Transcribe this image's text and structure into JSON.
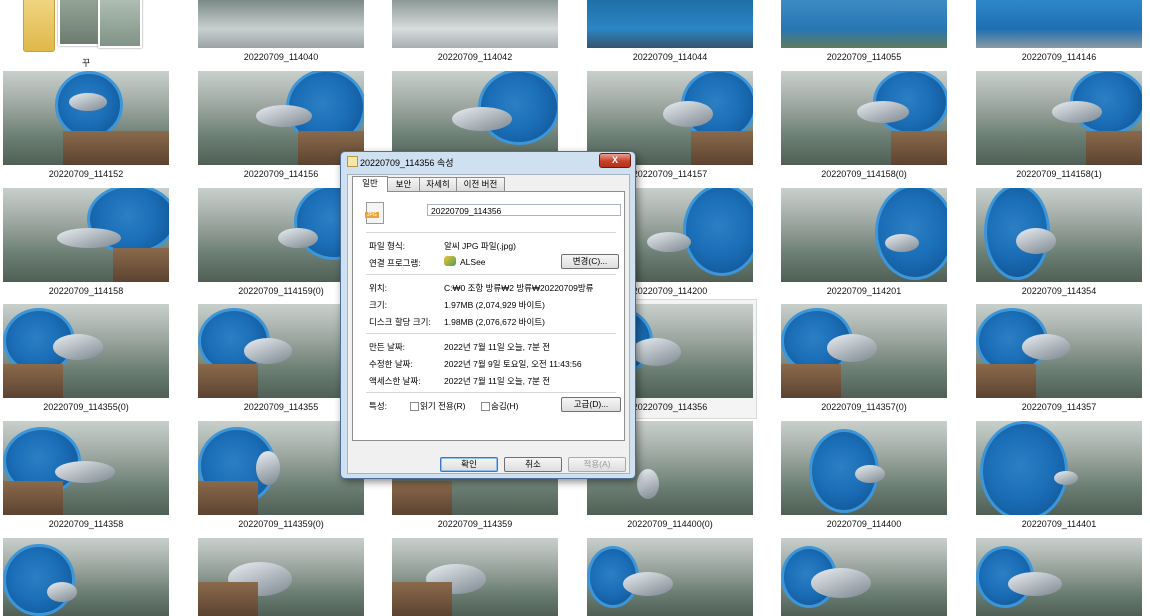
{
  "folder_caption": "꾸",
  "row0": [
    "20220709_114040",
    "20220709_114042",
    "20220709_114044",
    "20220709_114055",
    "20220709_114146"
  ],
  "row1": [
    "20220709_114152",
    "20220709_114156",
    "",
    "20220709_114157",
    "20220709_114158(0)",
    "20220709_114158(1)"
  ],
  "row2": [
    "20220709_114158",
    "20220709_114159(0)",
    "",
    "20220709_114200",
    "20220709_114201",
    "20220709_114354"
  ],
  "row3": [
    "20220709_114355(0)",
    "20220709_114355",
    "",
    "20220709_114356",
    "20220709_114357(0)",
    "20220709_114357"
  ],
  "row4": [
    "20220709_114358",
    "20220709_114359(0)",
    "20220709_114359",
    "20220709_114400(0)",
    "20220709_114400",
    "20220709_114401"
  ],
  "dialog": {
    "title": "20220709_114356 속성",
    "close_label": "X",
    "tabs": [
      "일반",
      "보안",
      "자세히",
      "이전 버전"
    ],
    "file_icon_text": "JPG",
    "filename": "20220709_114356",
    "type_label": "파일 형식:",
    "type_value": "알씨 JPG 파일(.jpg)",
    "opens_label": "연결 프로그램:",
    "opens_value": "ALSee",
    "change_button": "변경(C)...",
    "location_label": "위치:",
    "location_value": "C:₩0 조항 방류₩2 방류₩20220709방류",
    "size_label": "크기:",
    "size_value": "1.97MB (2,074,929 바이트)",
    "disk_label": "디스크 할당 크기:",
    "disk_value": "1.98MB (2,076,672 바이트)",
    "created_label": "만든 날짜:",
    "created_value": "2022년 7월 11일 오늘, 7분 전",
    "modified_label": "수정한 날짜:",
    "modified_value": "2022년 7월 9일 토요일, 오전 11:43:56",
    "accessed_label": "액세스한 날짜:",
    "accessed_value": "2022년 7월 11일 오늘, 7분 전",
    "attributes_label": "특성:",
    "readonly_label": "읽기 전용(R)",
    "hidden_label": "숨김(H)",
    "advanced_button": "고급(D)...",
    "ok_button": "확인",
    "cancel_button": "취소",
    "apply_button": "적용(A)"
  }
}
